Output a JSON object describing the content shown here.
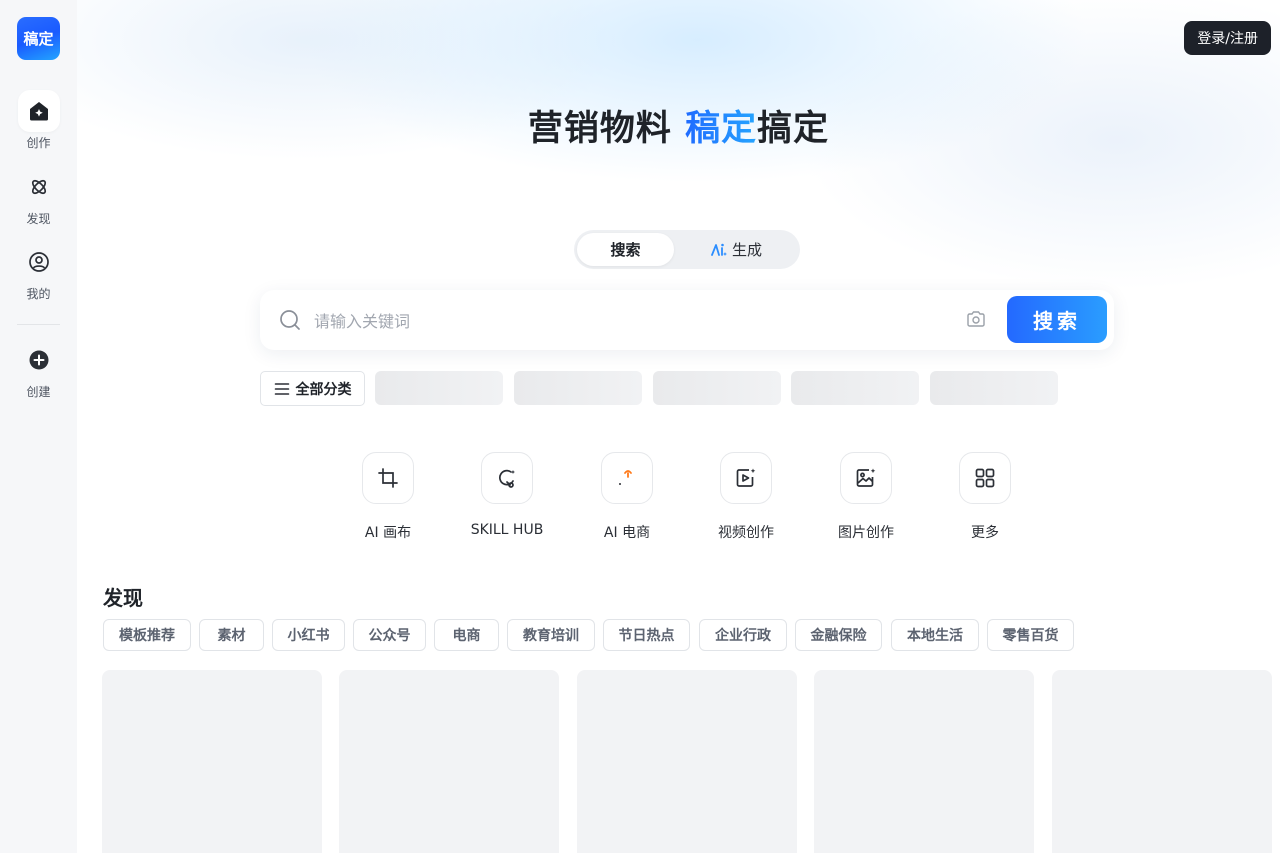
{
  "sidebar": {
    "logo_text": "稿定",
    "items": [
      {
        "label": "创作",
        "icon": "home-icon"
      },
      {
        "label": "发现",
        "icon": "discover-icon"
      },
      {
        "label": "我的",
        "icon": "user-icon"
      },
      {
        "label": "创建",
        "icon": "plus-circle-icon"
      }
    ]
  },
  "header": {
    "login_label": "登录/注册"
  },
  "hero": {
    "title_part1": "营销物料 ",
    "title_accent": "稿定",
    "title_part2": "搞定"
  },
  "mode_switch": {
    "search_label": "搜索",
    "generate_label": "生成"
  },
  "search": {
    "placeholder": "请输入关键词",
    "button_label": "搜索"
  },
  "categories": {
    "all_label": "全部分类"
  },
  "tools": [
    {
      "label": "AI 画布",
      "icon": "crop-canvas-icon"
    },
    {
      "label": "SKILL HUB",
      "icon": "skill-hub-icon"
    },
    {
      "label": "AI 电商",
      "icon": "ecommerce-icon"
    },
    {
      "label": "视频创作",
      "icon": "video-create-icon"
    },
    {
      "label": "图片创作",
      "icon": "image-create-icon"
    },
    {
      "label": "更多",
      "icon": "grid-more-icon"
    }
  ],
  "discover": {
    "title": "发现",
    "tags": [
      "模板推荐",
      "素材",
      "小红书",
      "公众号",
      "电商",
      "教育培训",
      "节日热点",
      "企业行政",
      "金融保险",
      "本地生活",
      "零售百货"
    ]
  },
  "colors": {
    "accent": "#2469ff",
    "dark": "#1d2129",
    "sidebar_bg": "#f6f7f9"
  }
}
